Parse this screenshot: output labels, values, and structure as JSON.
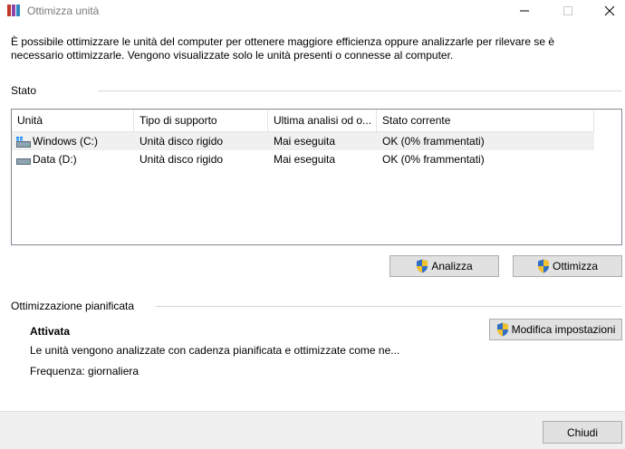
{
  "window": {
    "title": "Ottimizza unità"
  },
  "intro_text": "È possibile ottimizzare le unità del computer per ottenere maggiore efficienza oppure analizzarle per rilevare se è necessario ottimizzarle. Vengono visualizzate solo le unità presenti o connesse al computer.",
  "status_section": {
    "label": "Stato",
    "columns": [
      "Unità",
      "Tipo di supporto",
      "Ultima analisi od o...",
      "Stato corrente"
    ],
    "rows": [
      {
        "icon": "windows-drive-icon",
        "drive": "Windows (C:)",
        "media_type": "Unità disco rigido",
        "last_run": "Mai eseguita",
        "status": "OK (0% frammentati)"
      },
      {
        "icon": "hard-drive-icon",
        "drive": "Data (D:)",
        "media_type": "Unità disco rigido",
        "last_run": "Mai eseguita",
        "status": "OK (0% frammentati)"
      }
    ],
    "analyze_button": "Analizza",
    "optimize_button": "Ottimizza"
  },
  "schedule_section": {
    "label": "Ottimizzazione pianificata",
    "status": "Attivata",
    "description": "Le unità vengono analizzate con cadenza pianificata e ottimizzate come ne...",
    "frequency": "Frequenza: giornaliera",
    "change_settings_button": "Modifica impostazioni"
  },
  "footer": {
    "close_button": "Chiudi"
  },
  "colors": {
    "shield_blue": "#2f6fc4",
    "shield_yellow": "#f2c22e",
    "button_face": "#e1e1e1",
    "selected_row": "#f0f0f0"
  }
}
